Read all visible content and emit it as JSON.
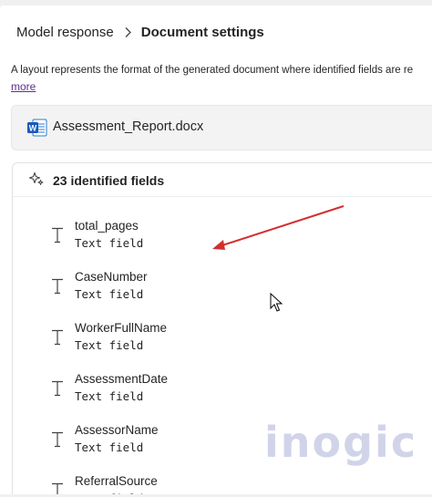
{
  "breadcrumb": {
    "parent": "Model response",
    "current": "Document settings"
  },
  "description": {
    "text": "A layout represents the format of the generated document where identified fields are re",
    "more_link": "more"
  },
  "file": {
    "name": "Assessment_Report.docx",
    "icon": "word-document-icon"
  },
  "fields_panel": {
    "count_label": "23 identified fields",
    "icon": "sparkle-icon",
    "items": [
      {
        "name": "total_pages",
        "type": "Text field"
      },
      {
        "name": "CaseNumber",
        "type": "Text field"
      },
      {
        "name": "WorkerFullName",
        "type": "Text field"
      },
      {
        "name": "AssessmentDate",
        "type": "Text field"
      },
      {
        "name": "AssessorName",
        "type": "Text field"
      },
      {
        "name": "ReferralSource",
        "type": "Text field"
      }
    ]
  },
  "watermark": "inogic",
  "colors": {
    "link": "#5c2e91",
    "annotation_arrow": "#d32f2f",
    "word_blue": "#185abd"
  }
}
